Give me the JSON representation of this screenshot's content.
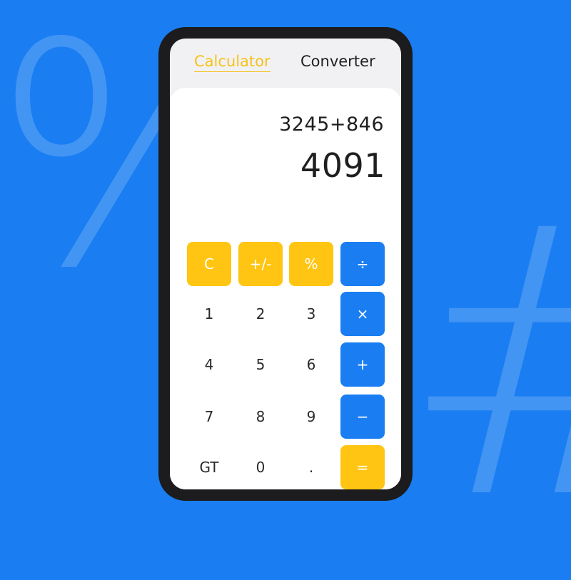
{
  "background": {
    "color": "#1a7ef2",
    "symbols": [
      "%",
      "#"
    ]
  },
  "tabs": [
    {
      "label": "Calculator",
      "active": true
    },
    {
      "label": "Converter",
      "active": false
    }
  ],
  "display": {
    "expression": "3245+846",
    "result": "4091"
  },
  "keys": {
    "clear": "C",
    "sign": "+/-",
    "percent": "%",
    "divide": "÷",
    "multiply": "×",
    "plus": "+",
    "minus": "−",
    "equals": "=",
    "d1": "1",
    "d2": "2",
    "d3": "3",
    "d4": "4",
    "d5": "5",
    "d6": "6",
    "d7": "7",
    "d8": "8",
    "d9": "9",
    "d0": "0",
    "gt": "GT",
    "dot": "."
  },
  "colors": {
    "accent_yellow": "#ffc512",
    "accent_blue": "#1a7ef2",
    "tab_active": "#f6c21a"
  }
}
